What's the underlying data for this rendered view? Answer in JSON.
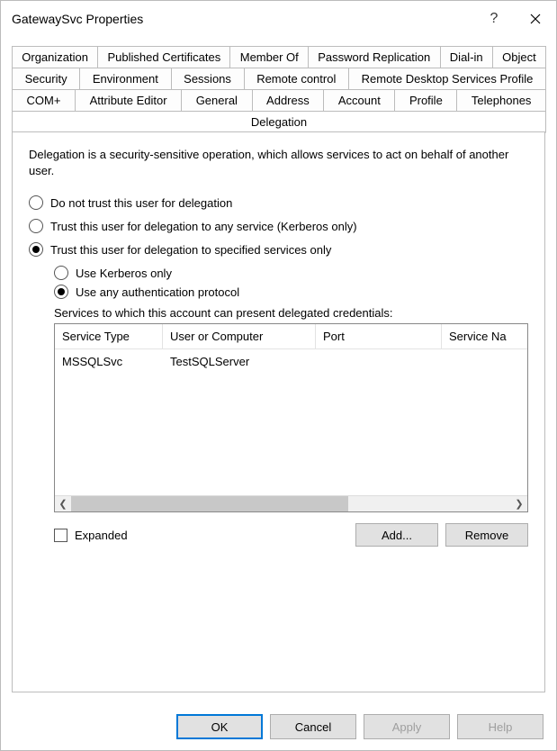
{
  "window": {
    "title": "GatewaySvc Properties"
  },
  "tabs": {
    "row1": [
      "Organization",
      "Published Certificates",
      "Member Of",
      "Password Replication"
    ],
    "row2": [
      "Dial-in",
      "Object",
      "Security",
      "Environment",
      "Sessions"
    ],
    "row3": [
      "Remote control",
      "Remote Desktop Services Profile",
      "COM+",
      "Attribute Editor"
    ],
    "row4": [
      "General",
      "Address",
      "Account",
      "Profile",
      "Telephones",
      "Delegation"
    ],
    "active": "Delegation"
  },
  "delegation": {
    "description": "Delegation is a security-sensitive operation, which allows services to act on behalf of another user.",
    "opt_no_trust": "Do not trust this user for delegation",
    "opt_any": "Trust this user for delegation to any service (Kerberos only)",
    "opt_specified": "Trust this user for delegation to specified services only",
    "sub_kerb": "Use Kerberos only",
    "sub_any_auth": "Use any authentication protocol",
    "services_label": "Services to which this account can present delegated credentials:",
    "columns": [
      "Service Type",
      "User or Computer",
      "Port",
      "Service Na"
    ],
    "rows": [
      {
        "service_type": "MSSQLSvc",
        "user_or_computer": "TestSQLServer",
        "port": "",
        "service_name": ""
      }
    ],
    "expanded_label": "Expanded",
    "add_label": "Add...",
    "remove_label": "Remove"
  },
  "buttons": {
    "ok": "OK",
    "cancel": "Cancel",
    "apply": "Apply",
    "help": "Help"
  }
}
